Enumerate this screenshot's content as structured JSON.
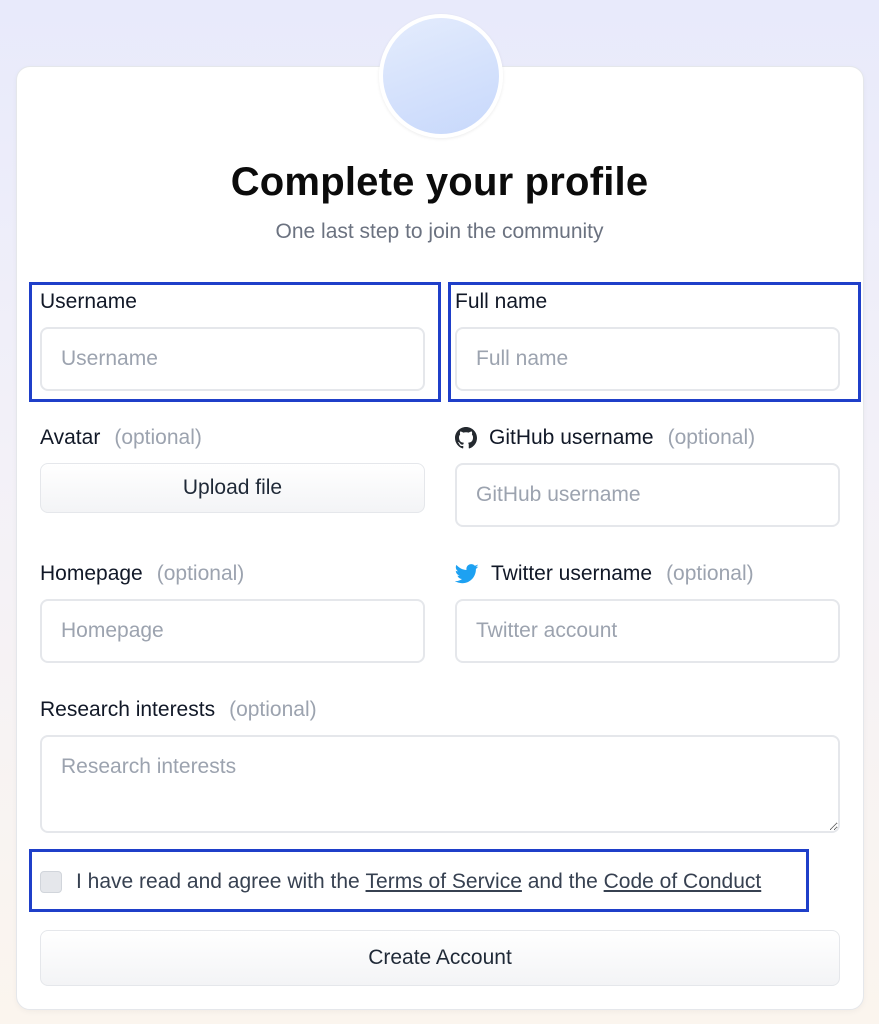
{
  "header": {
    "title": "Complete your profile",
    "subtitle": "One last step to join the community"
  },
  "fields": {
    "username": {
      "label": "Username",
      "placeholder": "Username"
    },
    "fullname": {
      "label": "Full name",
      "placeholder": "Full name"
    },
    "avatar": {
      "label": "Avatar",
      "optional": "(optional)",
      "button_label": "Upload file"
    },
    "github": {
      "label": "GitHub username",
      "optional": "(optional)",
      "placeholder": "GitHub username",
      "icon": "github-icon"
    },
    "homepage": {
      "label": "Homepage",
      "optional": "(optional)",
      "placeholder": "Homepage"
    },
    "twitter": {
      "label": "Twitter username",
      "optional": "(optional)",
      "placeholder": "Twitter account",
      "icon": "twitter-icon"
    },
    "research": {
      "label": "Research interests",
      "optional": "(optional)",
      "placeholder": "Research interests"
    }
  },
  "terms": {
    "prefix": "I have read and agree with the ",
    "tos_link": "Terms of Service",
    "middle": " and the ",
    "coc_link": "Code of Conduct",
    "checked": false
  },
  "submit": {
    "label": "Create Account"
  },
  "colors": {
    "highlight": "#1f3fc9",
    "twitter": "#1da1f2",
    "placeholder": "#9ca3af"
  }
}
